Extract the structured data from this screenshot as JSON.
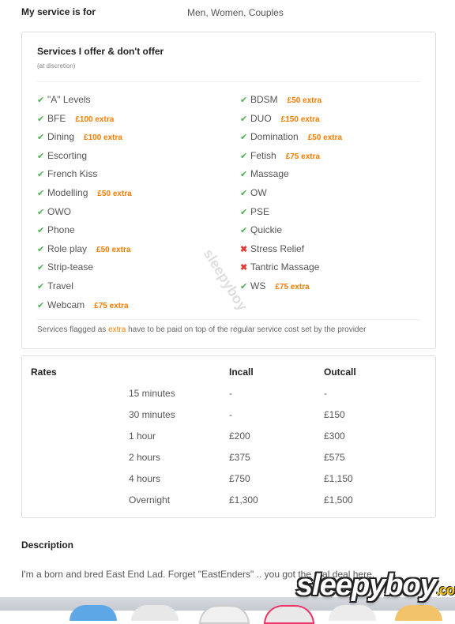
{
  "service_for": {
    "label": "My service is for",
    "value": "Men, Women, Couples"
  },
  "services": {
    "title": "Services I offer & don't offer",
    "subtitle": "(at discretion)",
    "left": [
      {
        "name": "\"A\" Levels",
        "offered": true,
        "extra": ""
      },
      {
        "name": "BFE",
        "offered": true,
        "extra": "£100 extra"
      },
      {
        "name": "Dining",
        "offered": true,
        "extra": "£100 extra"
      },
      {
        "name": "Escorting",
        "offered": true,
        "extra": ""
      },
      {
        "name": "French Kiss",
        "offered": true,
        "extra": ""
      },
      {
        "name": "Modelling",
        "offered": true,
        "extra": "£50 extra"
      },
      {
        "name": "OWO",
        "offered": true,
        "extra": ""
      },
      {
        "name": "Phone",
        "offered": true,
        "extra": ""
      },
      {
        "name": "Role play",
        "offered": true,
        "extra": "£50 extra"
      },
      {
        "name": "Strip-tease",
        "offered": true,
        "extra": ""
      },
      {
        "name": "Travel",
        "offered": true,
        "extra": ""
      },
      {
        "name": "Webcam",
        "offered": true,
        "extra": "£75 extra"
      }
    ],
    "right": [
      {
        "name": "BDSM",
        "offered": true,
        "extra": "£50 extra"
      },
      {
        "name": "DUO",
        "offered": true,
        "extra": "£150 extra"
      },
      {
        "name": "Domination",
        "offered": true,
        "extra": "£50 extra"
      },
      {
        "name": "Fetish",
        "offered": true,
        "extra": "£75 extra"
      },
      {
        "name": "Massage",
        "offered": true,
        "extra": ""
      },
      {
        "name": "OW",
        "offered": true,
        "extra": ""
      },
      {
        "name": "PSE",
        "offered": true,
        "extra": ""
      },
      {
        "name": "Quickie",
        "offered": true,
        "extra": ""
      },
      {
        "name": "Stress Relief",
        "offered": false,
        "extra": ""
      },
      {
        "name": "Tantric Massage",
        "offered": false,
        "extra": ""
      },
      {
        "name": "WS",
        "offered": true,
        "extra": "£75 extra"
      }
    ],
    "note_before": "Services flagged as ",
    "note_highlight": "extra",
    "note_after": " have to be paid on top of the regular service cost set by the provider"
  },
  "rates": {
    "title": "Rates",
    "incall_header": "Incall",
    "outcall_header": "Outcall",
    "rows": [
      {
        "duration": "15 minutes",
        "incall": "-",
        "outcall": "-"
      },
      {
        "duration": "30 minutes",
        "incall": "-",
        "outcall": "£150"
      },
      {
        "duration": "1 hour",
        "incall": "£200",
        "outcall": "£300"
      },
      {
        "duration": "2 hours",
        "incall": "£375",
        "outcall": "£575"
      },
      {
        "duration": "4 hours",
        "incall": "£750",
        "outcall": "£1,150"
      },
      {
        "duration": "Overnight",
        "incall": "£1,300",
        "outcall": "£1,500"
      }
    ]
  },
  "description": {
    "title": "Description",
    "text": "I'm a born and bred East End Lad. Forget \"EastEnders\" .. you got the real deal here."
  },
  "watermark": "sleepyboy",
  "logo": {
    "main": "sleepyboy",
    "domain": ".com"
  },
  "colors": {
    "check": "#4caf50",
    "cross": "#e53935",
    "extra": "#f57c00"
  }
}
